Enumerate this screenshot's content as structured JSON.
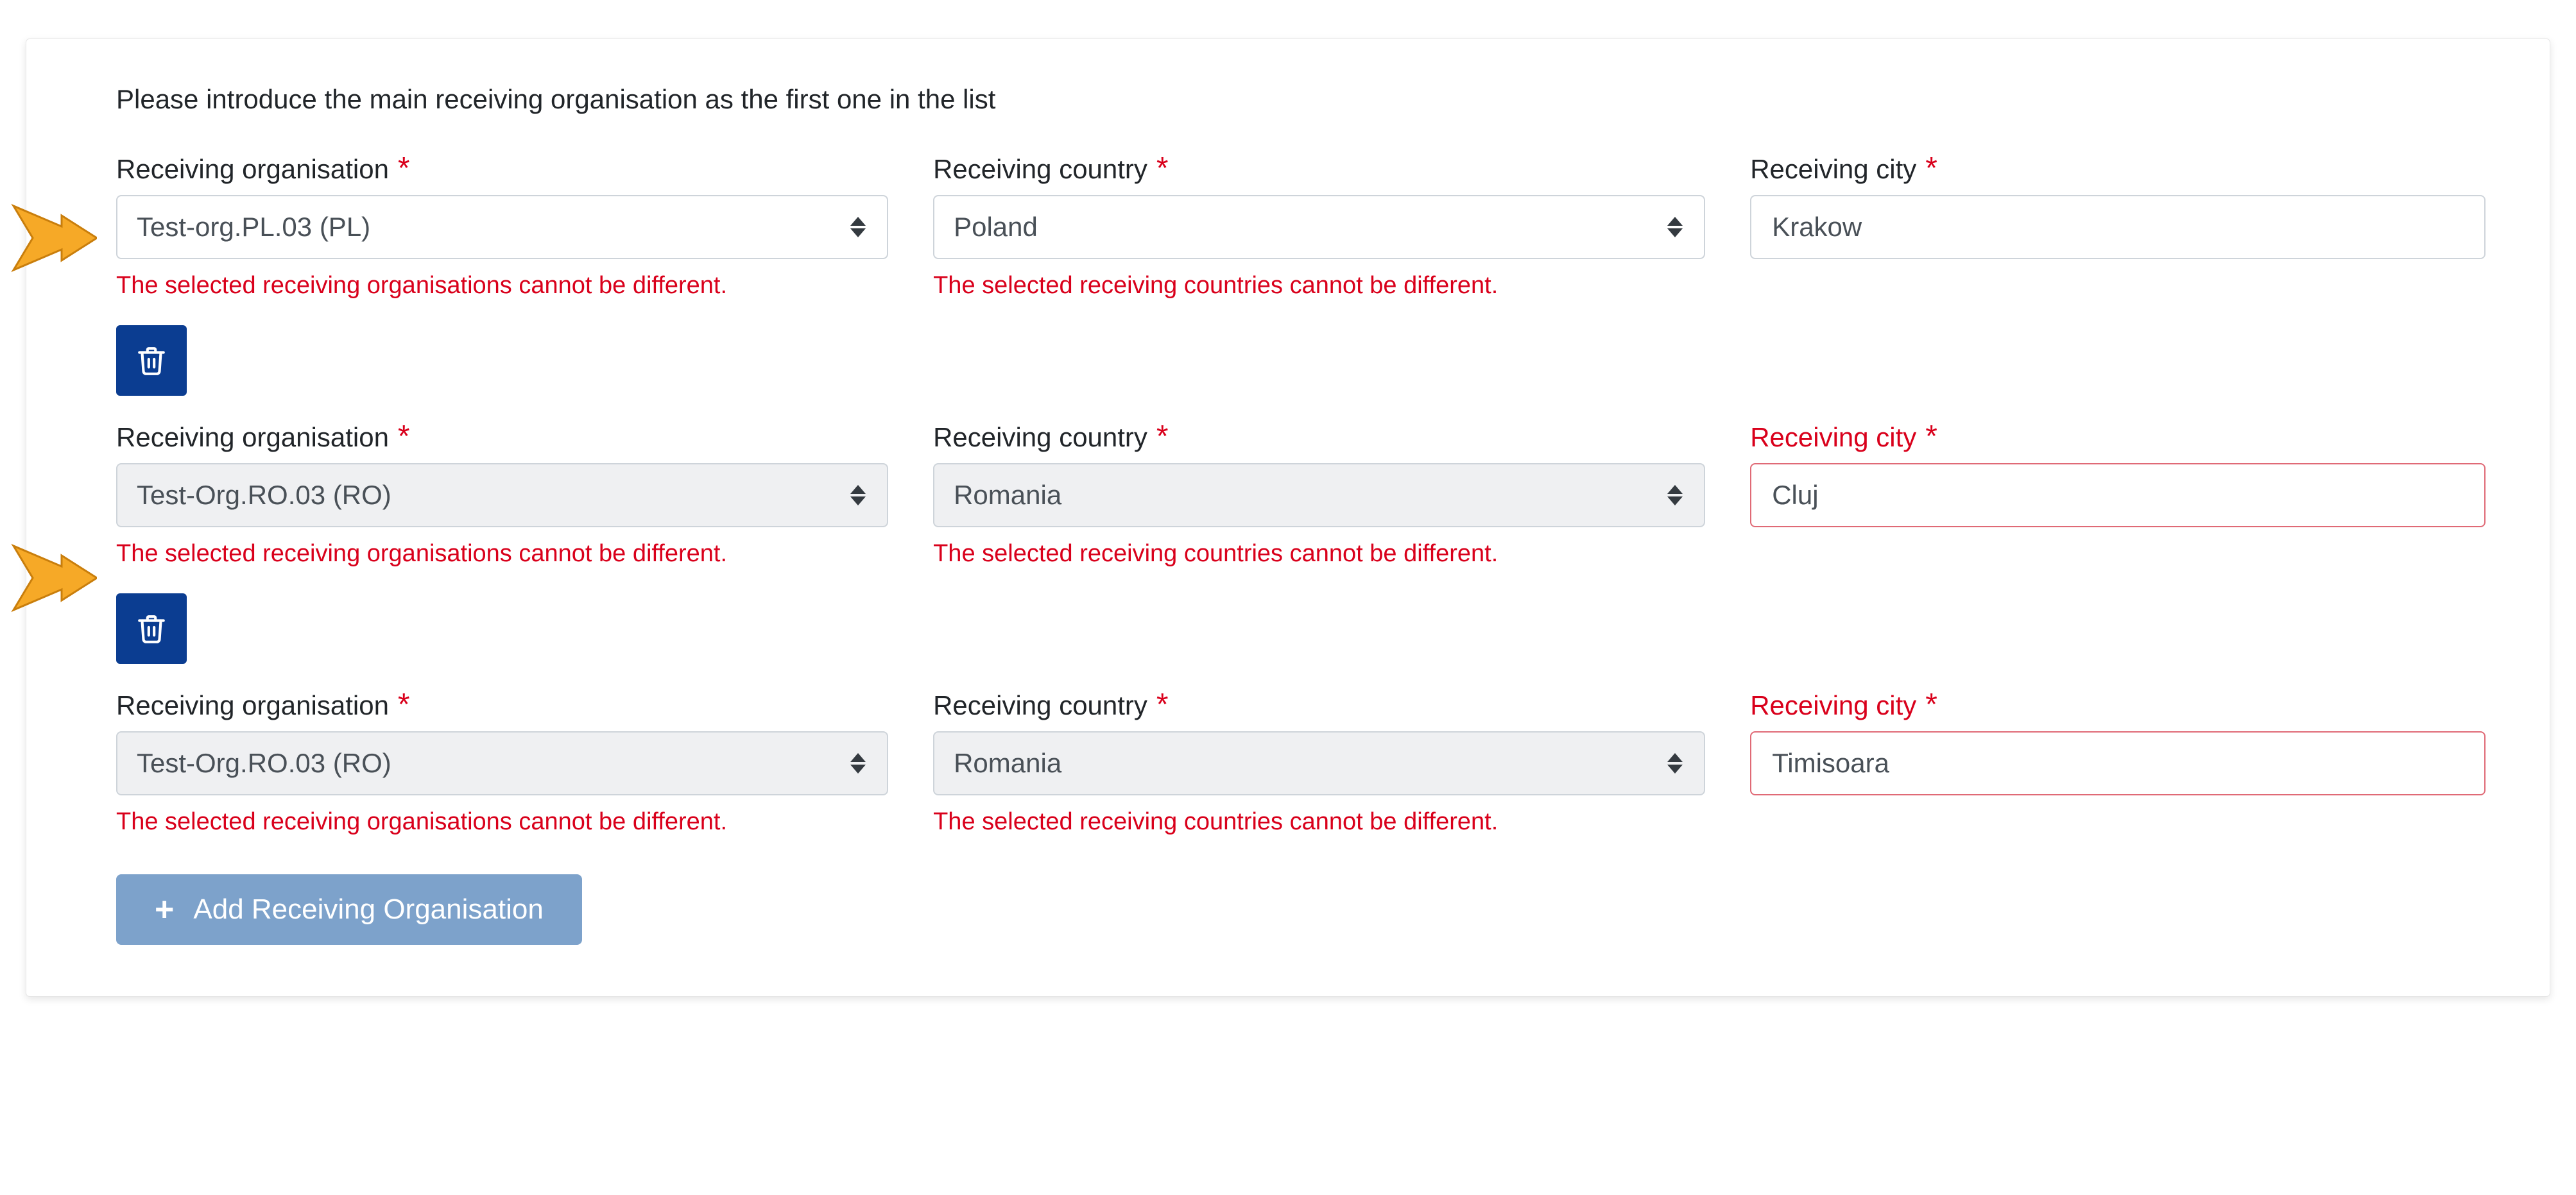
{
  "intro": "Please introduce the main receiving organisation as the first one in the list",
  "labels": {
    "org": "Receiving organisation",
    "country": "Receiving country",
    "city": "Receiving city"
  },
  "errors": {
    "org": "The selected receiving organisations cannot be different.",
    "country": "The selected receiving countries cannot be different."
  },
  "rows": [
    {
      "org": "Test-org.PL.03 (PL)",
      "country": "Poland",
      "city": "Krakow",
      "org_disabled": false,
      "country_disabled": false,
      "city_error": false,
      "deletable": false
    },
    {
      "org": "Test-Org.RO.03 (RO)",
      "country": "Romania",
      "city": "Cluj",
      "org_disabled": true,
      "country_disabled": true,
      "city_error": true,
      "deletable": true
    },
    {
      "org": "Test-Org.RO.03 (RO)",
      "country": "Romania",
      "city": "Timisoara",
      "org_disabled": true,
      "country_disabled": true,
      "city_error": true,
      "deletable": true
    }
  ],
  "add_button": "Add Receiving Organisation"
}
